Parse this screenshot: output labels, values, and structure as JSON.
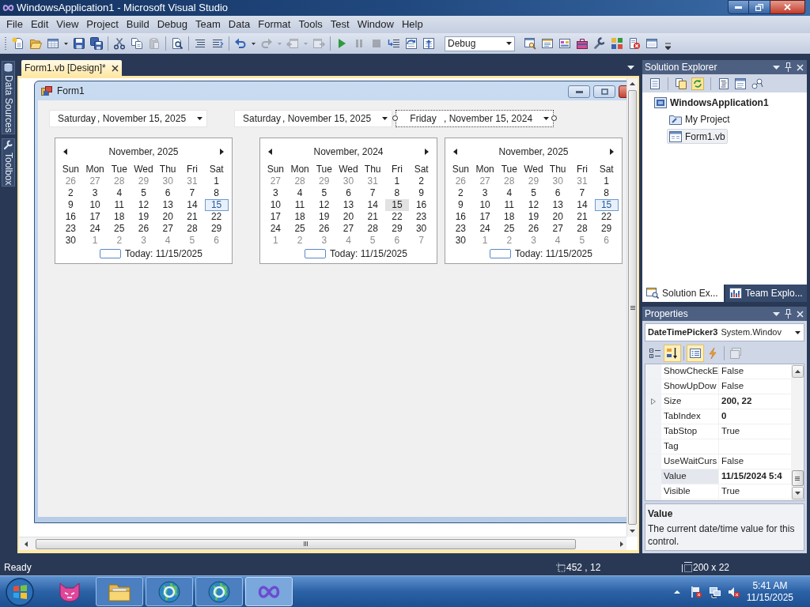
{
  "window": {
    "title": "WindowsApplication1 - Microsoft Visual Studio"
  },
  "menu": [
    "File",
    "Edit",
    "View",
    "Project",
    "Build",
    "Debug",
    "Team",
    "Data",
    "Format",
    "Tools",
    "Test",
    "Window",
    "Help"
  ],
  "toolbar": {
    "items": [
      {
        "kind": "new-project",
        "disabled": false
      },
      {
        "kind": "open",
        "disabled": false
      },
      {
        "kind": "add-item",
        "disabled": false
      },
      {
        "kind": "save",
        "disabled": false
      },
      {
        "kind": "save-all",
        "disabled": false
      },
      {
        "kind": "separator"
      },
      {
        "kind": "cut",
        "disabled": false
      },
      {
        "kind": "copy",
        "disabled": false
      },
      {
        "kind": "paste",
        "disabled": true
      },
      {
        "kind": "separator"
      },
      {
        "kind": "find-in-files",
        "disabled": false
      },
      {
        "kind": "separator"
      },
      {
        "kind": "comment",
        "disabled": false
      },
      {
        "kind": "uncomment",
        "disabled": false
      },
      {
        "kind": "separator"
      },
      {
        "kind": "undo",
        "disabled": false
      },
      {
        "kind": "redo",
        "disabled": true
      },
      {
        "kind": "back",
        "disabled": true
      },
      {
        "kind": "forward",
        "disabled": true
      },
      {
        "kind": "separator"
      },
      {
        "kind": "start",
        "disabled": false
      },
      {
        "kind": "pause",
        "disabled": true
      },
      {
        "kind": "stop",
        "disabled": true
      },
      {
        "kind": "step-into",
        "disabled": false
      },
      {
        "kind": "step-over",
        "disabled": false
      },
      {
        "kind": "step-out",
        "disabled": false
      },
      {
        "kind": "configuration",
        "value": "Debug"
      },
      {
        "kind": "find-symbol",
        "disabled": false
      },
      {
        "kind": "properties",
        "disabled": false
      },
      {
        "kind": "object-browser",
        "disabled": false
      },
      {
        "kind": "toolbox",
        "disabled": false
      },
      {
        "kind": "tools",
        "disabled": false
      },
      {
        "kind": "extensions",
        "disabled": false
      },
      {
        "kind": "error-list",
        "disabled": false
      },
      {
        "kind": "command-window",
        "disabled": false
      }
    ]
  },
  "side_tabs": [
    {
      "kind": "data",
      "label": "Data Sources"
    },
    {
      "kind": "toolbox",
      "label": "Toolbox"
    }
  ],
  "designer": {
    "tabs": [
      {
        "label": "Form1.vb [Design]*",
        "selected": true
      }
    ],
    "form": {
      "title": "Form1",
      "date_pickers": [
        {
          "day": "Saturday",
          "date": ", November 15, 2025",
          "selected": false
        },
        {
          "day": "Saturday",
          "date": ", November 15, 2025",
          "selected": false
        },
        {
          "day": "Friday",
          "date": ", November 15, 2024",
          "selected": true
        }
      ],
      "calendars": [
        {
          "title": "November, 2025",
          "weekdays": [
            "Sun",
            "Mon",
            "Tue",
            "Wed",
            "Thu",
            "Fri",
            "Sat"
          ],
          "weeks": [
            [
              {
                "day": "26",
                "dim": true,
                "selected": false,
                "today": false
              },
              {
                "day": "27",
                "dim": true,
                "selected": false,
                "today": false
              },
              {
                "day": "28",
                "dim": true,
                "selected": false,
                "today": false
              },
              {
                "day": "29",
                "dim": true,
                "selected": false,
                "today": false
              },
              {
                "day": "30",
                "dim": true,
                "selected": false,
                "today": false
              },
              {
                "day": "31",
                "dim": true,
                "selected": false,
                "today": false
              },
              {
                "day": "1",
                "dim": false,
                "selected": false,
                "today": false
              }
            ],
            [
              {
                "day": "2",
                "dim": false,
                "selected": false,
                "today": false
              },
              {
                "day": "3",
                "dim": false,
                "selected": false,
                "today": false
              },
              {
                "day": "4",
                "dim": false,
                "selected": false,
                "today": false
              },
              {
                "day": "5",
                "dim": false,
                "selected": false,
                "today": false
              },
              {
                "day": "6",
                "dim": false,
                "selected": false,
                "today": false
              },
              {
                "day": "7",
                "dim": false,
                "selected": false,
                "today": false
              },
              {
                "day": "8",
                "dim": false,
                "selected": false,
                "today": false
              }
            ],
            [
              {
                "day": "9",
                "dim": false,
                "selected": false,
                "today": false
              },
              {
                "day": "10",
                "dim": false,
                "selected": false,
                "today": false
              },
              {
                "day": "11",
                "dim": false,
                "selected": false,
                "today": false
              },
              {
                "day": "12",
                "dim": false,
                "selected": false,
                "today": false
              },
              {
                "day": "13",
                "dim": false,
                "selected": false,
                "today": false
              },
              {
                "day": "14",
                "dim": false,
                "selected": false,
                "today": false
              },
              {
                "day": "15",
                "dim": false,
                "selected": true,
                "today": true
              }
            ],
            [
              {
                "day": "16",
                "dim": false,
                "selected": false,
                "today": false
              },
              {
                "day": "17",
                "dim": false,
                "selected": false,
                "today": false
              },
              {
                "day": "18",
                "dim": false,
                "selected": false,
                "today": false
              },
              {
                "day": "19",
                "dim": false,
                "selected": false,
                "today": false
              },
              {
                "day": "20",
                "dim": false,
                "selected": false,
                "today": false
              },
              {
                "day": "21",
                "dim": false,
                "selected": false,
                "today": false
              },
              {
                "day": "22",
                "dim": false,
                "selected": false,
                "today": false
              }
            ],
            [
              {
                "day": "23",
                "dim": false,
                "selected": false,
                "today": false
              },
              {
                "day": "24",
                "dim": false,
                "selected": false,
                "today": false
              },
              {
                "day": "25",
                "dim": false,
                "selected": false,
                "today": false
              },
              {
                "day": "26",
                "dim": false,
                "selected": false,
                "today": false
              },
              {
                "day": "27",
                "dim": false,
                "selected": false,
                "today": false
              },
              {
                "day": "28",
                "dim": false,
                "selected": false,
                "today": false
              },
              {
                "day": "29",
                "dim": false,
                "selected": false,
                "today": false
              }
            ],
            [
              {
                "day": "30",
                "dim": false,
                "selected": false,
                "today": false
              },
              {
                "day": "1",
                "dim": true,
                "selected": false,
                "today": false
              },
              {
                "day": "2",
                "dim": true,
                "selected": false,
                "today": false
              },
              {
                "day": "3",
                "dim": true,
                "selected": false,
                "today": false
              },
              {
                "day": "4",
                "dim": true,
                "selected": false,
                "today": false
              },
              {
                "day": "5",
                "dim": true,
                "selected": false,
                "today": false
              },
              {
                "day": "6",
                "dim": true,
                "selected": false,
                "today": false
              }
            ]
          ],
          "today_label": "Today: 11/15/2025"
        },
        {
          "title": "November, 2024",
          "weekdays": [
            "Sun",
            "Mon",
            "Tue",
            "Wed",
            "Thu",
            "Fri",
            "Sat"
          ],
          "weeks": [
            [
              {
                "day": "27",
                "dim": true,
                "selected": false,
                "today": false
              },
              {
                "day": "28",
                "dim": true,
                "selected": false,
                "today": false
              },
              {
                "day": "29",
                "dim": true,
                "selected": false,
                "today": false
              },
              {
                "day": "30",
                "dim": true,
                "selected": false,
                "today": false
              },
              {
                "day": "31",
                "dim": true,
                "selected": false,
                "today": false
              },
              {
                "day": "1",
                "dim": false,
                "selected": false,
                "today": false
              },
              {
                "day": "2",
                "dim": false,
                "selected": false,
                "today": false
              }
            ],
            [
              {
                "day": "3",
                "dim": false,
                "selected": false,
                "today": false
              },
              {
                "day": "4",
                "dim": false,
                "selected": false,
                "today": false
              },
              {
                "day": "5",
                "dim": false,
                "selected": false,
                "today": false
              },
              {
                "day": "6",
                "dim": false,
                "selected": false,
                "today": false
              },
              {
                "day": "7",
                "dim": false,
                "selected": false,
                "today": false
              },
              {
                "day": "8",
                "dim": false,
                "selected": false,
                "today": false
              },
              {
                "day": "9",
                "dim": false,
                "selected": false,
                "today": false
              }
            ],
            [
              {
                "day": "10",
                "dim": false,
                "selected": false,
                "today": false
              },
              {
                "day": "11",
                "dim": false,
                "selected": false,
                "today": false
              },
              {
                "day": "12",
                "dim": false,
                "selected": false,
                "today": false
              },
              {
                "day": "13",
                "dim": false,
                "selected": false,
                "today": false
              },
              {
                "day": "14",
                "dim": false,
                "selected": false,
                "today": false
              },
              {
                "day": "15",
                "dim": false,
                "selected": true,
                "today": false
              },
              {
                "day": "16",
                "dim": false,
                "selected": false,
                "today": false
              }
            ],
            [
              {
                "day": "17",
                "dim": false,
                "selected": false,
                "today": false
              },
              {
                "day": "18",
                "dim": false,
                "selected": false,
                "today": false
              },
              {
                "day": "19",
                "dim": false,
                "selected": false,
                "today": false
              },
              {
                "day": "20",
                "dim": false,
                "selected": false,
                "today": false
              },
              {
                "day": "21",
                "dim": false,
                "selected": false,
                "today": false
              },
              {
                "day": "22",
                "dim": false,
                "selected": false,
                "today": false
              },
              {
                "day": "23",
                "dim": false,
                "selected": false,
                "today": false
              }
            ],
            [
              {
                "day": "24",
                "dim": false,
                "selected": false,
                "today": false
              },
              {
                "day": "25",
                "dim": false,
                "selected": false,
                "today": false
              },
              {
                "day": "26",
                "dim": false,
                "selected": false,
                "today": false
              },
              {
                "day": "27",
                "dim": false,
                "selected": false,
                "today": false
              },
              {
                "day": "28",
                "dim": false,
                "selected": false,
                "today": false
              },
              {
                "day": "29",
                "dim": false,
                "selected": false,
                "today": false
              },
              {
                "day": "30",
                "dim": false,
                "selected": false,
                "today": false
              }
            ],
            [
              {
                "day": "1",
                "dim": true,
                "selected": false,
                "today": false
              },
              {
                "day": "2",
                "dim": true,
                "selected": false,
                "today": false
              },
              {
                "day": "3",
                "dim": true,
                "selected": false,
                "today": false
              },
              {
                "day": "4",
                "dim": true,
                "selected": false,
                "today": false
              },
              {
                "day": "5",
                "dim": true,
                "selected": false,
                "today": false
              },
              {
                "day": "6",
                "dim": true,
                "selected": false,
                "today": false
              },
              {
                "day": "7",
                "dim": true,
                "selected": false,
                "today": false
              }
            ]
          ],
          "today_label": "Today: 11/15/2025"
        },
        {
          "title": "November, 2025",
          "weekdays": [
            "Sun",
            "Mon",
            "Tue",
            "Wed",
            "Thu",
            "Fri",
            "Sat"
          ],
          "weeks": [
            [
              {
                "day": "26",
                "dim": true,
                "selected": false,
                "today": false
              },
              {
                "day": "27",
                "dim": true,
                "selected": false,
                "today": false
              },
              {
                "day": "28",
                "dim": true,
                "selected": false,
                "today": false
              },
              {
                "day": "29",
                "dim": true,
                "selected": false,
                "today": false
              },
              {
                "day": "30",
                "dim": true,
                "selected": false,
                "today": false
              },
              {
                "day": "31",
                "dim": true,
                "selected": false,
                "today": false
              },
              {
                "day": "1",
                "dim": false,
                "selected": false,
                "today": false
              }
            ],
            [
              {
                "day": "2",
                "dim": false,
                "selected": false,
                "today": false
              },
              {
                "day": "3",
                "dim": false,
                "selected": false,
                "today": false
              },
              {
                "day": "4",
                "dim": false,
                "selected": false,
                "today": false
              },
              {
                "day": "5",
                "dim": false,
                "selected": false,
                "today": false
              },
              {
                "day": "6",
                "dim": false,
                "selected": false,
                "today": false
              },
              {
                "day": "7",
                "dim": false,
                "selected": false,
                "today": false
              },
              {
                "day": "8",
                "dim": false,
                "selected": false,
                "today": false
              }
            ],
            [
              {
                "day": "9",
                "dim": false,
                "selected": false,
                "today": false
              },
              {
                "day": "10",
                "dim": false,
                "selected": false,
                "today": false
              },
              {
                "day": "11",
                "dim": false,
                "selected": false,
                "today": false
              },
              {
                "day": "12",
                "dim": false,
                "selected": false,
                "today": false
              },
              {
                "day": "13",
                "dim": false,
                "selected": false,
                "today": false
              },
              {
                "day": "14",
                "dim": false,
                "selected": false,
                "today": false
              },
              {
                "day": "15",
                "dim": false,
                "selected": true,
                "today": true
              }
            ],
            [
              {
                "day": "16",
                "dim": false,
                "selected": false,
                "today": false
              },
              {
                "day": "17",
                "dim": false,
                "selected": false,
                "today": false
              },
              {
                "day": "18",
                "dim": false,
                "selected": false,
                "today": false
              },
              {
                "day": "19",
                "dim": false,
                "selected": false,
                "today": false
              },
              {
                "day": "20",
                "dim": false,
                "selected": false,
                "today": false
              },
              {
                "day": "21",
                "dim": false,
                "selected": false,
                "today": false
              },
              {
                "day": "22",
                "dim": false,
                "selected": false,
                "today": false
              }
            ],
            [
              {
                "day": "23",
                "dim": false,
                "selected": false,
                "today": false
              },
              {
                "day": "24",
                "dim": false,
                "selected": false,
                "today": false
              },
              {
                "day": "25",
                "dim": false,
                "selected": false,
                "today": false
              },
              {
                "day": "26",
                "dim": false,
                "selected": false,
                "today": false
              },
              {
                "day": "27",
                "dim": false,
                "selected": false,
                "today": false
              },
              {
                "day": "28",
                "dim": false,
                "selected": false,
                "today": false
              },
              {
                "day": "29",
                "dim": false,
                "selected": false,
                "today": false
              }
            ],
            [
              {
                "day": "30",
                "dim": false,
                "selected": false,
                "today": false
              },
              {
                "day": "1",
                "dim": true,
                "selected": false,
                "today": false
              },
              {
                "day": "2",
                "dim": true,
                "selected": false,
                "today": false
              },
              {
                "day": "3",
                "dim": true,
                "selected": false,
                "today": false
              },
              {
                "day": "4",
                "dim": true,
                "selected": false,
                "today": false
              },
              {
                "day": "5",
                "dim": true,
                "selected": false,
                "today": false
              },
              {
                "day": "6",
                "dim": true,
                "selected": false,
                "today": false
              }
            ]
          ],
          "today_label": "Today: 11/15/2025"
        }
      ]
    }
  },
  "solution_explorer": {
    "title": "Solution Explorer",
    "tree": [
      {
        "kind": "project",
        "label": "WindowsApplication1",
        "bold": true,
        "selected": false,
        "children": [
          {
            "kind": "settings",
            "label": "My Project",
            "bold": false,
            "selected": false
          },
          {
            "kind": "form",
            "label": "Form1.vb",
            "bold": false,
            "selected": true
          }
        ]
      }
    ],
    "tabs": [
      {
        "kind": "solution",
        "label": "Solution Ex...",
        "selected": true
      },
      {
        "kind": "team",
        "label": "Team Explo...",
        "selected": false
      }
    ]
  },
  "properties": {
    "title": "Properties",
    "object_name": "DateTimePicker3",
    "object_type": "System.Windov",
    "toolbar": [
      {
        "kind": "categorized",
        "on": false,
        "disabled": false
      },
      {
        "kind": "alphabetical",
        "on": true,
        "disabled": false
      },
      {
        "kind": "separator"
      },
      {
        "kind": "properties",
        "on": true,
        "disabled": false
      },
      {
        "kind": "events",
        "on": false,
        "disabled": false
      },
      {
        "kind": "separator"
      },
      {
        "kind": "property-pages",
        "on": false,
        "disabled": true
      }
    ],
    "rows": [
      {
        "name": "ShowCheckE",
        "value": "False",
        "bold": false,
        "selected": false
      },
      {
        "name": "ShowUpDow",
        "value": "False",
        "bold": false,
        "selected": false
      },
      {
        "name": "Size",
        "value": "200, 22",
        "bold": true,
        "selected": false,
        "expanded": false
      },
      {
        "name": "TabIndex",
        "value": "0",
        "bold": true,
        "selected": false
      },
      {
        "name": "TabStop",
        "value": "True",
        "bold": false,
        "selected": false
      },
      {
        "name": "Tag",
        "bold": false,
        "selected": false
      },
      {
        "name": "UseWaitCurs",
        "value": "False",
        "bold": false,
        "selected": false
      },
      {
        "name": "Value",
        "value": "11/15/2024 5:4",
        "bold": true,
        "selected": true
      },
      {
        "name": "Visible",
        "value": "True",
        "bold": false,
        "selected": false
      }
    ],
    "description_title": "Value",
    "description": "The current date/time value for this control."
  },
  "status_bar": {
    "text": "Ready",
    "position": "452 , 12",
    "size": "200 x 22"
  },
  "taskbar": {
    "apps": [
      {
        "kind": "cat",
        "running": false,
        "active": false
      },
      {
        "kind": "folder",
        "running": true,
        "active": false
      },
      {
        "kind": "globe",
        "running": true,
        "active": false
      },
      {
        "kind": "globe",
        "running": true,
        "active": false
      },
      {
        "kind": "infinity",
        "running": true,
        "active": true
      }
    ],
    "time": "5:41 AM",
    "date": "11/15/2025"
  }
}
